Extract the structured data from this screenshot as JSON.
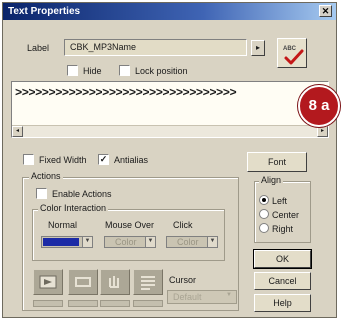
{
  "window": {
    "title": "Text Properties",
    "close_glyph": "✕"
  },
  "label": {
    "caption": "Label",
    "value": "CBK_MP3Name",
    "arrow": "▸",
    "abc_icon": "abc-spellcheck-icon",
    "abc_text": "ABC"
  },
  "options": {
    "hide": "Hide",
    "lock_position": "Lock position"
  },
  "text_content": ">>>>>>>>>>>>>>>>>>>>>>>>>>>>>>>>>",
  "badge": "8 a",
  "format": {
    "fixed_width": "Fixed Width",
    "antialias": "Antialias",
    "antialias_checked": true,
    "fixed_width_checked": false
  },
  "buttons": {
    "font": "Font",
    "ok": "OK",
    "cancel": "Cancel",
    "help": "Help"
  },
  "align": {
    "title": "Align",
    "options": [
      "Left",
      "Center",
      "Right"
    ],
    "selected": "Left"
  },
  "actions": {
    "title": "Actions",
    "enable": "Enable Actions",
    "color_interaction": {
      "title": "Color Interaction",
      "columns": [
        "Normal",
        "Mouse Over",
        "Click"
      ],
      "normal_color": "#1b2aa6",
      "mouse_over_value": "Color",
      "click_value": "Color"
    },
    "cursor_label": "Cursor",
    "cursor_value": "Default",
    "icons": [
      "play-sound-icon",
      "frame-icon",
      "cursor-hand-icon",
      "text-list-icon"
    ]
  },
  "scroll": {
    "left_arrow": "◂",
    "right_arrow": "▸"
  }
}
